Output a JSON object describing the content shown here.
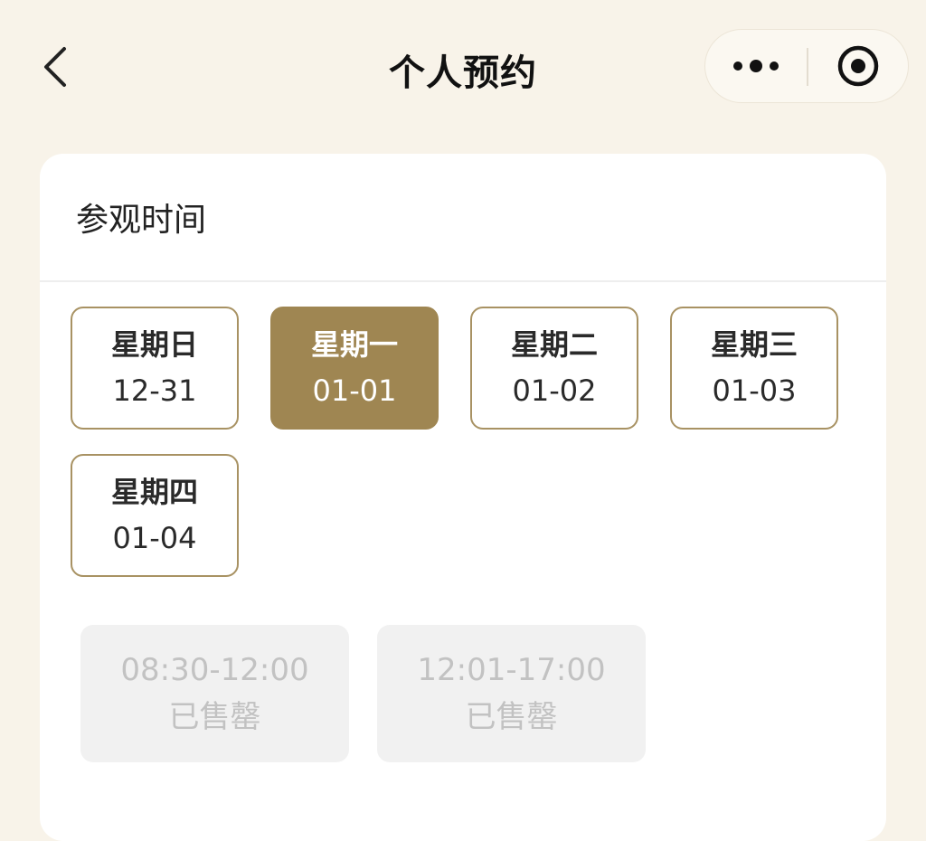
{
  "nav": {
    "title": "个人预约",
    "back_icon": "chevron-left-icon",
    "more_icon": "more-dots-icon",
    "close_icon": "target-circle-icon"
  },
  "section": {
    "title": "参观时间"
  },
  "dates": [
    {
      "dow": "星期日",
      "md": "12-31",
      "selected": false
    },
    {
      "dow": "星期一",
      "md": "01-01",
      "selected": true
    },
    {
      "dow": "星期二",
      "md": "01-02",
      "selected": false
    },
    {
      "dow": "星期三",
      "md": "01-03",
      "selected": false
    },
    {
      "dow": "星期四",
      "md": "01-04",
      "selected": false
    }
  ],
  "slots": [
    {
      "time": "08:30-12:00",
      "status": "已售罄"
    },
    {
      "time": "12:01-17:00",
      "status": "已售罄"
    }
  ],
  "colors": {
    "page_bg": "#f8f3e9",
    "accent": "#9f8652",
    "border": "#a89263",
    "disabled_bg": "#f1f1f1",
    "disabled_text": "#c2c2c2"
  }
}
